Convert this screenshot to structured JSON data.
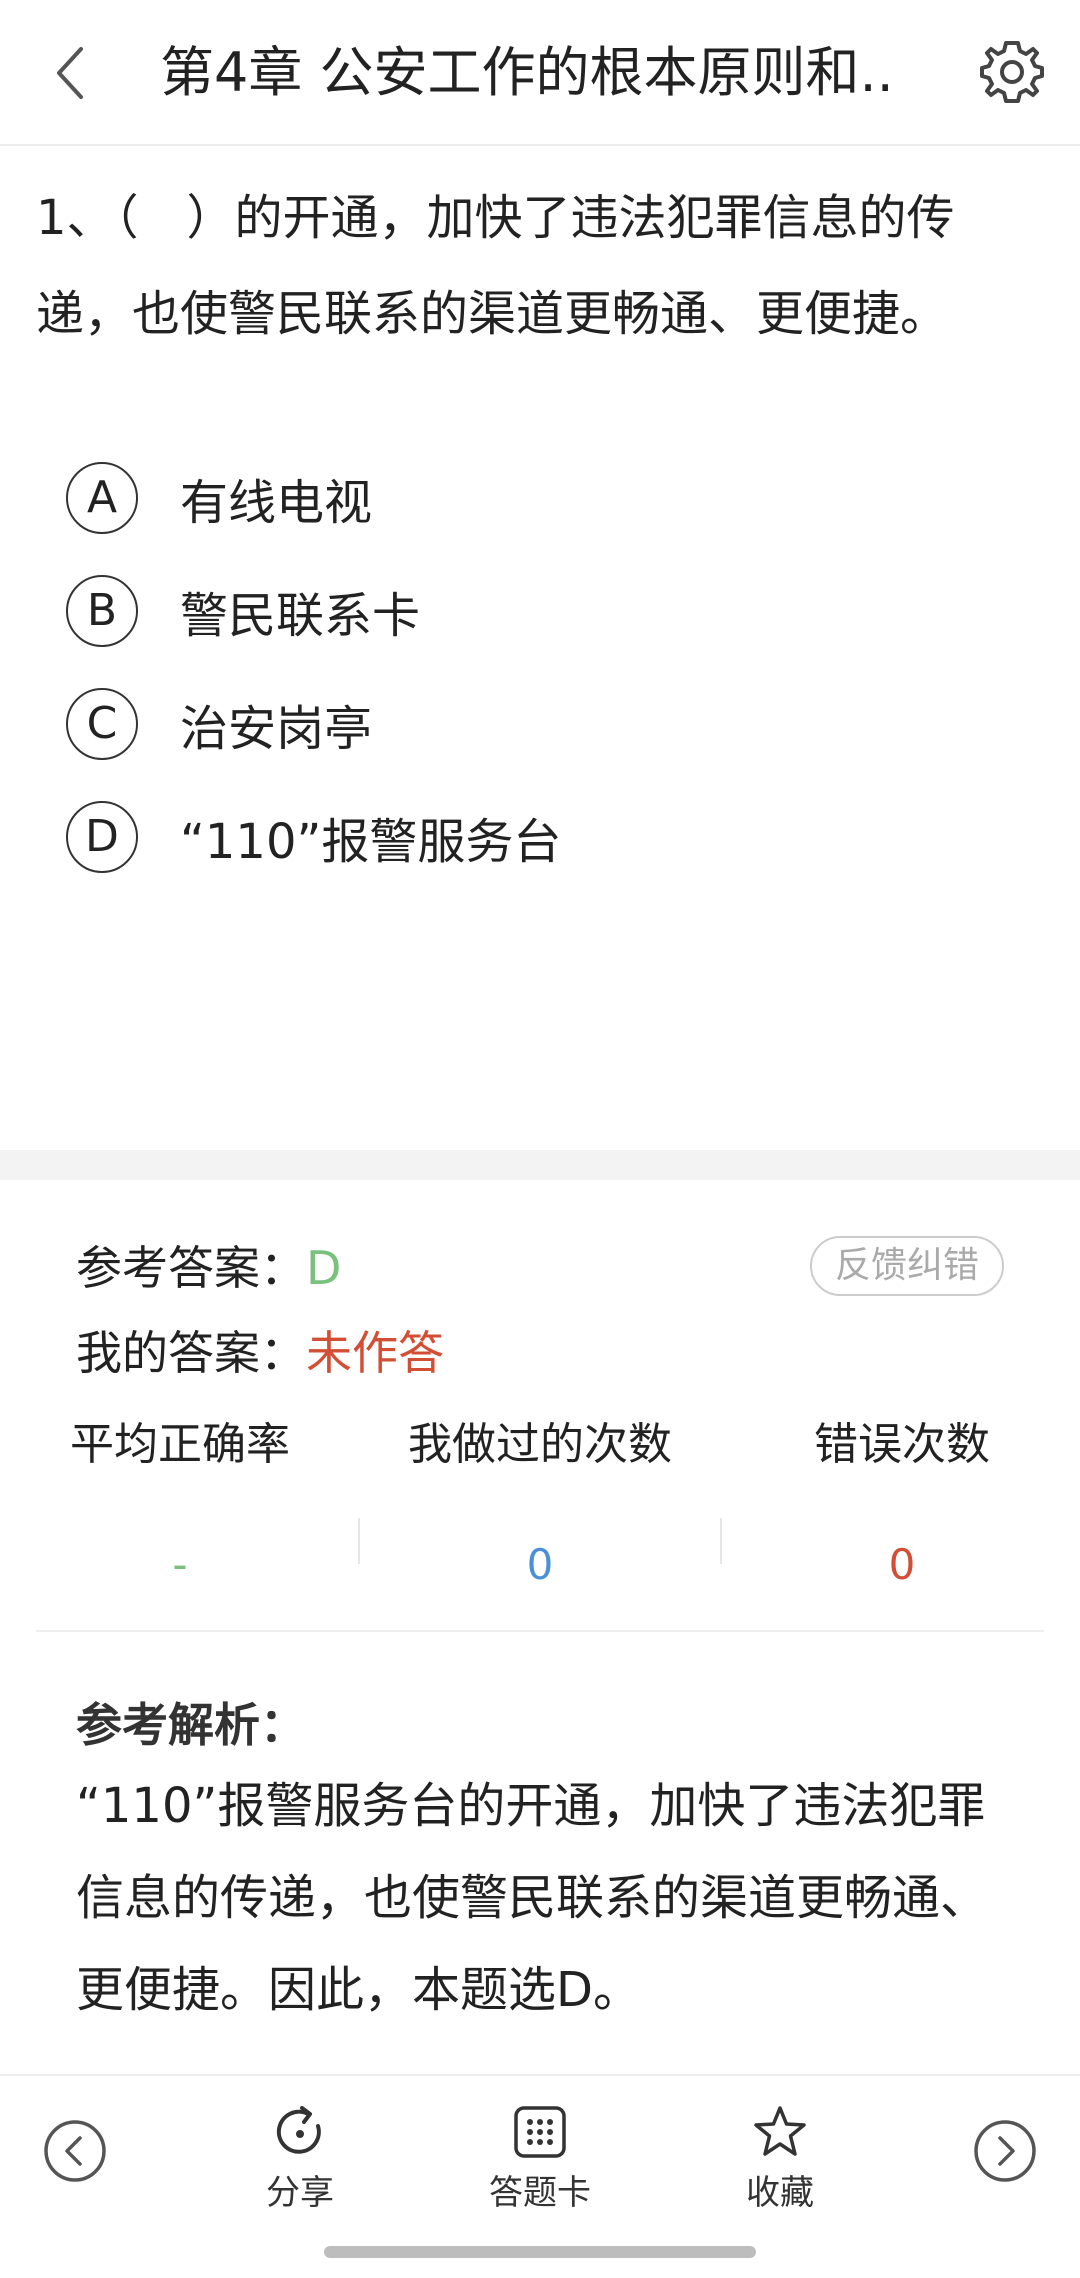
{
  "header": {
    "title": "第4章 公安工作的根本原则和..",
    "back_icon": "chevron-left-icon",
    "settings_icon": "gear-icon"
  },
  "question": {
    "text": "1、（　）的开通，加快了违法犯罪信息的传递，也使警民联系的渠道更畅通、更便捷。"
  },
  "options": [
    {
      "letter": "A",
      "text": "有线电视"
    },
    {
      "letter": "B",
      "text": "警民联系卡"
    },
    {
      "letter": "C",
      "text": "治安岗亭"
    },
    {
      "letter": "D",
      "text": "“110”报警服务台"
    }
  ],
  "answer": {
    "ref_label": "参考答案：",
    "ref_value": "D",
    "my_label": "我的答案：",
    "my_value": "未作答",
    "feedback_label": "反馈纠错"
  },
  "stats": [
    {
      "label": "平均正确率",
      "value": "-"
    },
    {
      "label": "我做过的次数",
      "value": "0"
    },
    {
      "label": "错误次数",
      "value": "0"
    }
  ],
  "analysis": {
    "title": "参考解析：",
    "text": "“110”报警服务台的开通，加快了违法犯罪信息的传递，也使警民联系的渠道更畅通、更便捷。因此，本题选D。"
  },
  "bottom": {
    "share_label": "分享",
    "card_label": "答题卡",
    "favorite_label": "收藏"
  },
  "colors": {
    "correct": "#7bc17e",
    "wrong": "#d24f35",
    "count": "#4a90d9"
  }
}
